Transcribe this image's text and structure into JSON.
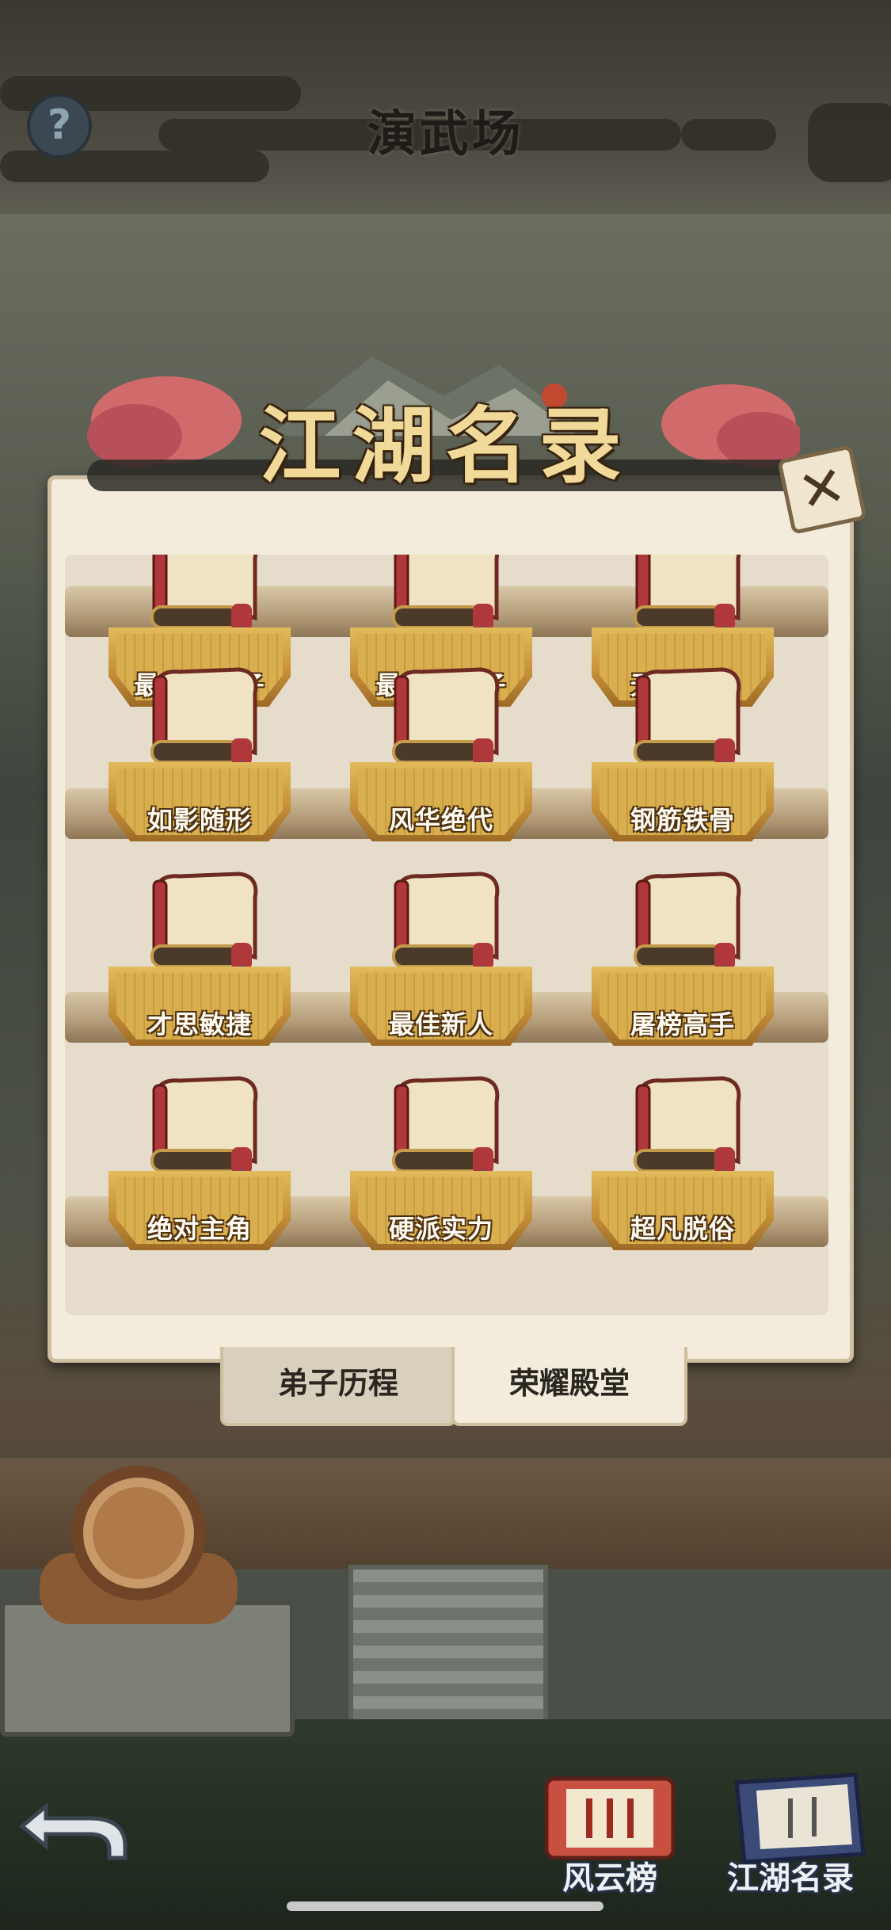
{
  "header": {
    "title": "演武场",
    "help_symbol": "?"
  },
  "modal": {
    "title": "江湖名录",
    "close_symbol": "✕",
    "awards": [
      {
        "label": "最佳男弟子"
      },
      {
        "label": "最佳女弟子"
      },
      {
        "label": "无坚不摧"
      },
      {
        "label": "如影随形"
      },
      {
        "label": "风华绝代"
      },
      {
        "label": "钢筋铁骨"
      },
      {
        "label": "才思敏捷"
      },
      {
        "label": "最佳新人"
      },
      {
        "label": "屠榜高手"
      },
      {
        "label": "绝对主角"
      },
      {
        "label": "硬派实力"
      },
      {
        "label": "超凡脱俗"
      }
    ],
    "tabs": [
      {
        "label": "弟子历程",
        "selected": false
      },
      {
        "label": "荣耀殿堂",
        "selected": true
      }
    ]
  },
  "bottom_nav": {
    "back_icon": "back-arrow-icon",
    "fengyun_label": "风云榜",
    "jianghu_label": "江湖名录"
  }
}
